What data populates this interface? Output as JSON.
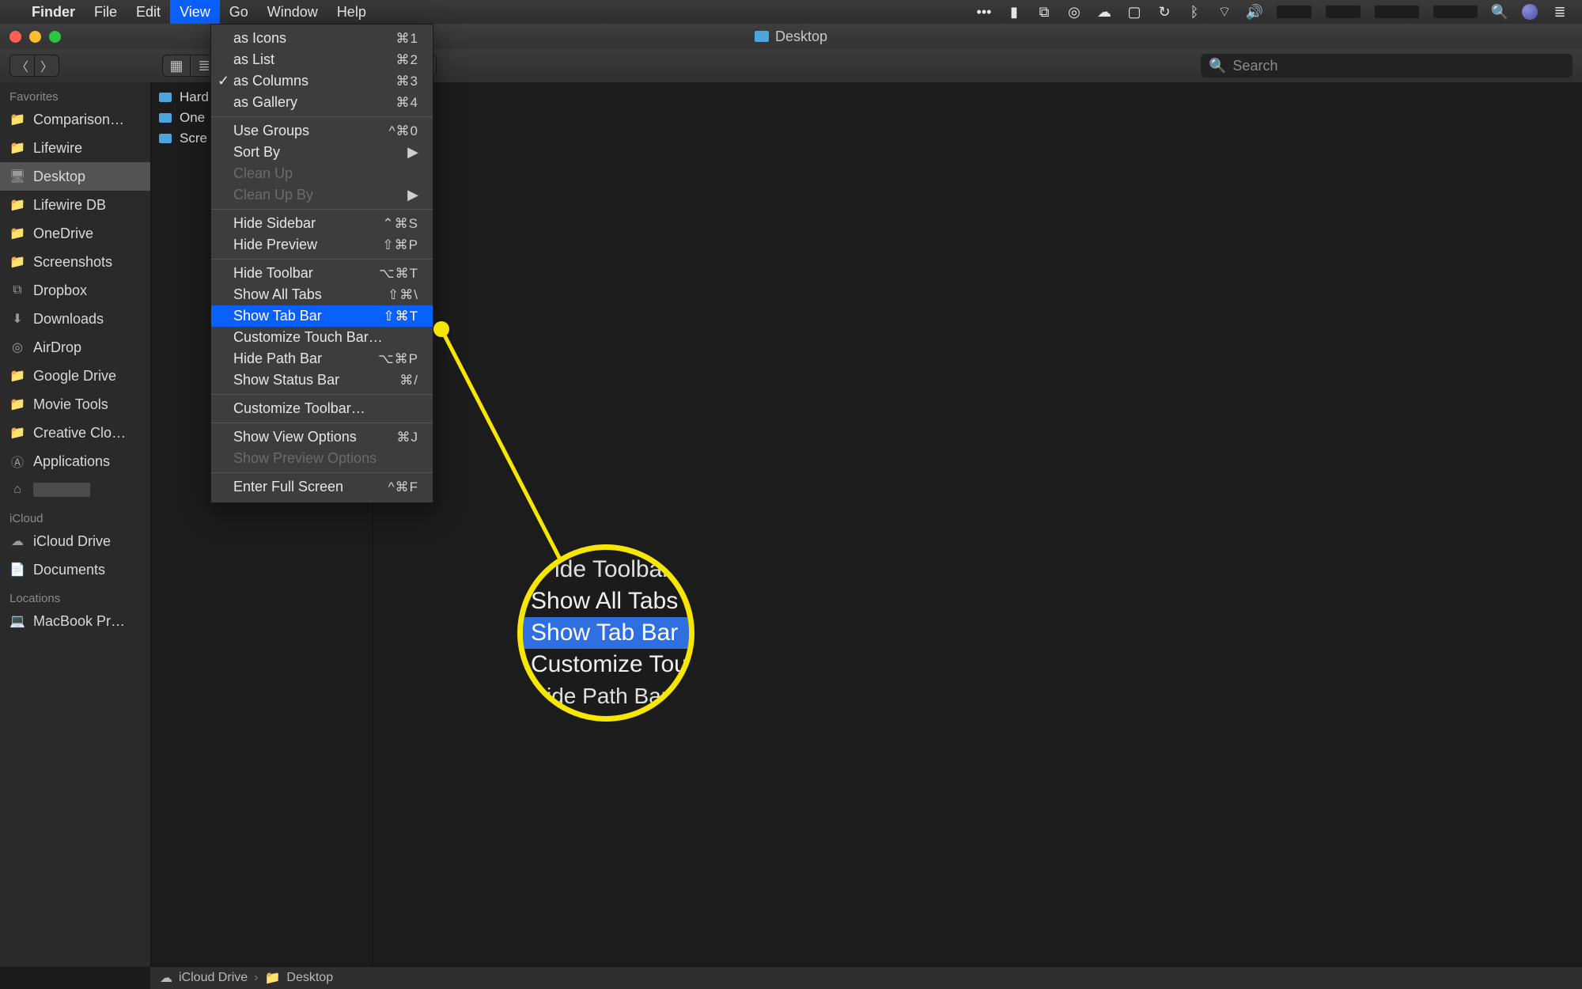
{
  "menubar": {
    "app": "Finder",
    "items": [
      "File",
      "Edit",
      "View",
      "Go",
      "Window",
      "Help"
    ],
    "active_index": 2
  },
  "statusbar_icons": [
    "battery",
    "dropbox",
    "creative-cloud",
    "cloud",
    "airplay",
    "time-machine",
    "bluetooth",
    "wifi",
    "volume"
  ],
  "window": {
    "title": "Desktop",
    "search_placeholder": "Search"
  },
  "sidebar": {
    "sections": [
      {
        "title": "Favorites",
        "items": [
          {
            "icon": "folder",
            "label": "Comparison…"
          },
          {
            "icon": "folder",
            "label": "Lifewire"
          },
          {
            "icon": "desktop",
            "label": "Desktop",
            "selected": true
          },
          {
            "icon": "folder",
            "label": "Lifewire DB"
          },
          {
            "icon": "folder",
            "label": "OneDrive"
          },
          {
            "icon": "folder",
            "label": "Screenshots"
          },
          {
            "icon": "dropbox",
            "label": "Dropbox"
          },
          {
            "icon": "downloads",
            "label": "Downloads"
          },
          {
            "icon": "airdrop",
            "label": "AirDrop"
          },
          {
            "icon": "folder",
            "label": "Google Drive"
          },
          {
            "icon": "folder",
            "label": "Movie Tools"
          },
          {
            "icon": "folder",
            "label": "Creative Clo…"
          },
          {
            "icon": "apps",
            "label": "Applications"
          },
          {
            "icon": "home",
            "label": ""
          }
        ]
      },
      {
        "title": "iCloud",
        "items": [
          {
            "icon": "cloud",
            "label": "iCloud Drive"
          },
          {
            "icon": "doc",
            "label": "Documents"
          }
        ]
      },
      {
        "title": "Locations",
        "items": [
          {
            "icon": "laptop",
            "label": "MacBook Pr…"
          }
        ]
      }
    ]
  },
  "columns": {
    "col1": [
      {
        "label": "Hard"
      },
      {
        "label": "One"
      },
      {
        "label": "Scre"
      }
    ]
  },
  "pathbar": {
    "segments": [
      {
        "icon": "cloud",
        "label": "iCloud Drive"
      },
      {
        "icon": "folder",
        "label": "Desktop"
      }
    ]
  },
  "view_menu": {
    "groups": [
      [
        {
          "label": "as Icons",
          "shortcut": "⌘1"
        },
        {
          "label": "as List",
          "shortcut": "⌘2"
        },
        {
          "label": "as Columns",
          "shortcut": "⌘3",
          "checked": true
        },
        {
          "label": "as Gallery",
          "shortcut": "⌘4"
        }
      ],
      [
        {
          "label": "Use Groups",
          "shortcut": "^⌘0"
        },
        {
          "label": "Sort By",
          "submenu": true
        },
        {
          "label": "Clean Up",
          "disabled": true
        },
        {
          "label": "Clean Up By",
          "disabled": true,
          "submenu": true
        }
      ],
      [
        {
          "label": "Hide Sidebar",
          "shortcut": "⌃⌘S"
        },
        {
          "label": "Hide Preview",
          "shortcut": "⇧⌘P"
        }
      ],
      [
        {
          "label": "Hide Toolbar",
          "shortcut": "⌥⌘T"
        },
        {
          "label": "Show All Tabs",
          "shortcut": "⇧⌘\\"
        },
        {
          "label": "Show Tab Bar",
          "shortcut": "⇧⌘T",
          "highlight": true
        },
        {
          "label": "Customize Touch Bar…"
        },
        {
          "label": "Hide Path Bar",
          "shortcut": "⌥⌘P"
        },
        {
          "label": "Show Status Bar",
          "shortcut": "⌘/"
        }
      ],
      [
        {
          "label": "Customize Toolbar…"
        }
      ],
      [
        {
          "label": "Show View Options",
          "shortcut": "⌘J"
        },
        {
          "label": "Show Preview Options",
          "disabled": true
        }
      ],
      [
        {
          "label": "Enter Full Screen",
          "shortcut": "^⌘F"
        }
      ]
    ]
  },
  "callout": {
    "zoom_lines": [
      {
        "text": "ide Toolbar"
      },
      {
        "text": "Show All Tabs"
      },
      {
        "text": "Show Tab Bar",
        "hl": true
      },
      {
        "text": "Customize Tou"
      },
      {
        "text": "ide Path Bar"
      }
    ]
  }
}
